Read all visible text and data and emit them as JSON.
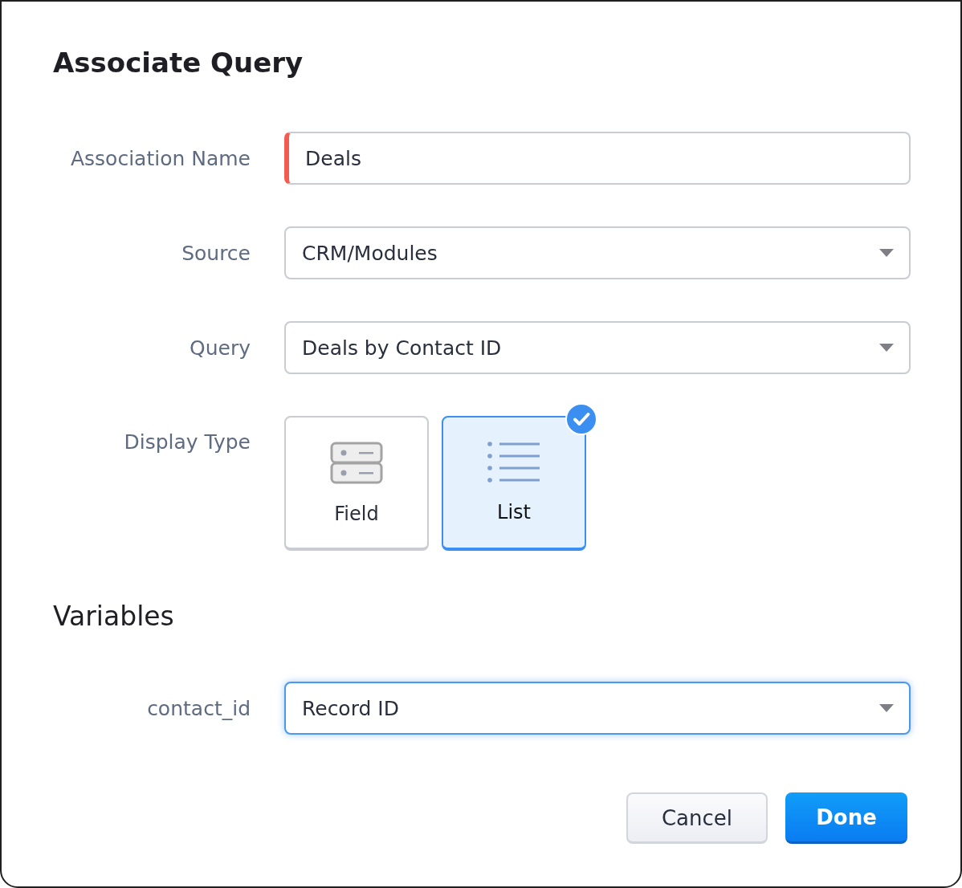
{
  "dialog": {
    "title": "Associate Query"
  },
  "fields": [
    {
      "label": "Association Name",
      "kind": "text",
      "value": "Deals",
      "required": true,
      "focused": false
    },
    {
      "label": "Source",
      "kind": "select",
      "value": "CRM/Modules",
      "required": false,
      "focused": false
    },
    {
      "label": "Query",
      "kind": "select",
      "value": "Deals by Contact ID",
      "required": false,
      "focused": false
    }
  ],
  "display_type": {
    "label": "Display Type",
    "options": [
      {
        "label": "Field",
        "kind": "field",
        "selected": false
      },
      {
        "label": "List",
        "kind": "list",
        "selected": true
      }
    ]
  },
  "variables": {
    "heading": "Variables",
    "items": [
      {
        "label": "contact_id",
        "kind": "select",
        "value": "Record ID",
        "required": false,
        "focused": true
      }
    ]
  },
  "buttons": [
    {
      "label": "Cancel",
      "kind": "secondary"
    },
    {
      "label": "Done",
      "kind": "primary"
    }
  ]
}
